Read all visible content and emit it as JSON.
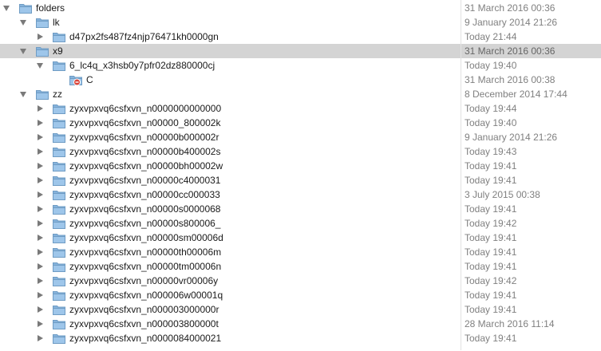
{
  "rows": [
    {
      "name": "folders",
      "date": "31 March 2016 00:36",
      "level": 0,
      "expanded": true,
      "kind": "folder",
      "selected": false
    },
    {
      "name": "lk",
      "date": "9 January 2014 21:26",
      "level": 1,
      "expanded": true,
      "kind": "folder",
      "selected": false
    },
    {
      "name": "d47px2fs487fz4njp76471kh0000gn",
      "date": "Today 21:44",
      "level": 2,
      "expanded": false,
      "kind": "folder",
      "selected": false
    },
    {
      "name": "x9",
      "date": "31 March 2016 00:36",
      "level": 1,
      "expanded": true,
      "kind": "folder",
      "selected": true
    },
    {
      "name": "6_lc4q_x3hsb0y7pfr02dz880000cj",
      "date": "Today 19:40",
      "level": 2,
      "expanded": true,
      "kind": "folder",
      "selected": false
    },
    {
      "name": "C",
      "date": "31 March 2016 00:38",
      "level": 3,
      "expanded": null,
      "kind": "restricted-folder",
      "selected": false
    },
    {
      "name": "zz",
      "date": "8 December 2014 17:44",
      "level": 1,
      "expanded": true,
      "kind": "folder",
      "selected": false
    },
    {
      "name": "zyxvpxvq6csfxvn_n0000000000000",
      "date": "Today 19:44",
      "level": 2,
      "expanded": false,
      "kind": "folder",
      "selected": false
    },
    {
      "name": "zyxvpxvq6csfxvn_n00000_800002k",
      "date": "Today 19:40",
      "level": 2,
      "expanded": false,
      "kind": "folder",
      "selected": false
    },
    {
      "name": "zyxvpxvq6csfxvn_n00000b000002r",
      "date": "9 January 2014 21:26",
      "level": 2,
      "expanded": false,
      "kind": "folder",
      "selected": false
    },
    {
      "name": "zyxvpxvq6csfxvn_n00000b400002s",
      "date": "Today 19:43",
      "level": 2,
      "expanded": false,
      "kind": "folder",
      "selected": false
    },
    {
      "name": "zyxvpxvq6csfxvn_n00000bh00002w",
      "date": "Today 19:41",
      "level": 2,
      "expanded": false,
      "kind": "folder",
      "selected": false
    },
    {
      "name": "zyxvpxvq6csfxvn_n00000c4000031",
      "date": "Today 19:41",
      "level": 2,
      "expanded": false,
      "kind": "folder",
      "selected": false
    },
    {
      "name": "zyxvpxvq6csfxvn_n00000cc000033",
      "date": "3 July 2015 00:38",
      "level": 2,
      "expanded": false,
      "kind": "folder",
      "selected": false
    },
    {
      "name": "zyxvpxvq6csfxvn_n00000s0000068",
      "date": "Today 19:41",
      "level": 2,
      "expanded": false,
      "kind": "folder",
      "selected": false
    },
    {
      "name": "zyxvpxvq6csfxvn_n00000s800006_",
      "date": "Today 19:42",
      "level": 2,
      "expanded": false,
      "kind": "folder",
      "selected": false
    },
    {
      "name": "zyxvpxvq6csfxvn_n00000sm00006d",
      "date": "Today 19:41",
      "level": 2,
      "expanded": false,
      "kind": "folder",
      "selected": false
    },
    {
      "name": "zyxvpxvq6csfxvn_n00000th00006m",
      "date": "Today 19:41",
      "level": 2,
      "expanded": false,
      "kind": "folder",
      "selected": false
    },
    {
      "name": "zyxvpxvq6csfxvn_n00000tm00006n",
      "date": "Today 19:41",
      "level": 2,
      "expanded": false,
      "kind": "folder",
      "selected": false
    },
    {
      "name": "zyxvpxvq6csfxvn_n00000vr00006y",
      "date": "Today 19:42",
      "level": 2,
      "expanded": false,
      "kind": "folder",
      "selected": false
    },
    {
      "name": "zyxvpxvq6csfxvn_n000006w00001q",
      "date": "Today 19:41",
      "level": 2,
      "expanded": false,
      "kind": "folder",
      "selected": false
    },
    {
      "name": "zyxvpxvq6csfxvn_n000003000000r",
      "date": "Today 19:41",
      "level": 2,
      "expanded": false,
      "kind": "folder",
      "selected": false
    },
    {
      "name": "zyxvpxvq6csfxvn_n000003800000t",
      "date": "28 March 2016 11:14",
      "level": 2,
      "expanded": false,
      "kind": "folder",
      "selected": false
    },
    {
      "name": "zyxvpxvq6csfxvn_n0000084000021",
      "date": "Today 19:41",
      "level": 2,
      "expanded": false,
      "kind": "folder",
      "selected": false
    }
  ],
  "colors": {
    "selection": "#d4d4d4",
    "folder_body": "#9ec6ea",
    "folder_outline": "#6f9cc4",
    "date_text": "#808080",
    "badge": "#d9443a"
  }
}
